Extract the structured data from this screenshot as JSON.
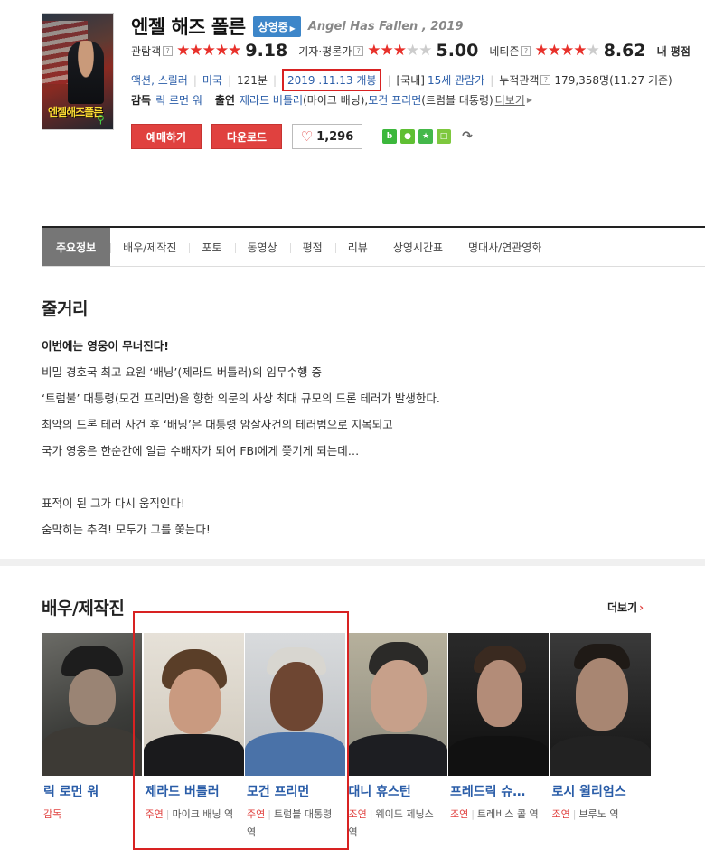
{
  "movie": {
    "poster_text": "엔젤해즈폴른",
    "title": "엔젤 해즈 폴른",
    "status": "상영중",
    "original_title": "Angel Has Fallen , 2019"
  },
  "ratings": {
    "audience": {
      "label": "관람객",
      "stars": 4.5,
      "score": "9.18"
    },
    "critics": {
      "label": "기자·평론가",
      "stars": 2.5,
      "score": "5.00"
    },
    "netizen": {
      "label": "네티즌",
      "stars": 4.5,
      "score": "8.62"
    },
    "extra": "내 평점"
  },
  "meta": {
    "genre": "액션, 스릴러",
    "country": "미국",
    "runtime": "121분",
    "release": "2019 .11.13 개봉",
    "grade_prefix": "[국내]",
    "grade": "15세 관람가",
    "audience_label": "누적관객",
    "audience_count": "179,358명",
    "audience_date": "(11.27 기준)"
  },
  "credits": {
    "director_label": "감독",
    "director": "릭 로먼 워",
    "cast_label": "출연",
    "actor1": "제라드 버틀러",
    "role1": "(마이크 배닝),",
    "actor2": "모건 프리먼",
    "role2": "(트럼블 대통령)",
    "more": "더보기"
  },
  "buttons": {
    "reserve": "예매하기",
    "download": "다운로드",
    "likes": "1,296"
  },
  "share_icons": [
    "blog-icon",
    "talk-icon",
    "star-icon",
    "square-icon",
    "share-icon"
  ],
  "tabs": [
    "주요정보",
    "배우/제작진",
    "포토",
    "동영상",
    "평점",
    "리뷰",
    "상영시간표",
    "명대사/연관영화"
  ],
  "synopsis": {
    "title": "줄거리",
    "lead": "이번에는 영웅이 무너진다!",
    "lines": [
      "비밀 경호국 최고 요원 ‘배닝’(제라드 버틀러)의 임무수행 중",
      " ‘트럼불’ 대통령(모건 프리먼)을 향한 의문의 사상 최대 규모의 드론 테러가 발생한다.",
      " 최악의 드론 테러 사건 후 ‘배닝’은 대통령 암살사건의 테러범으로 지목되고",
      " 국가 영웅은 한순간에 일급 수배자가 되어 FBI에게 쫓기게 되는데…",
      "",
      " 표적이 된 그가 다시 움직인다!",
      " 숨막히는 추격! 모두가 그를 쫓는다!"
    ]
  },
  "cast": {
    "title": "배우/제작진",
    "more": "더보기",
    "people": [
      {
        "name": "릭 로먼 워",
        "kind": "감독",
        "role": ""
      },
      {
        "name": "제라드 버틀러",
        "kind": "주연",
        "role": "마이크 배닝 역"
      },
      {
        "name": "모건 프리먼",
        "kind": "주연",
        "role": "트럼블 대통령 역"
      },
      {
        "name": "대니 휴스턴",
        "kind": "조연",
        "role": "웨이드 제닝스 역"
      },
      {
        "name": "프레드릭 슈…",
        "kind": "조연",
        "role": "트레비스 콜 역"
      },
      {
        "name": "로시 윌리엄스",
        "kind": "조연",
        "role": "브루노 역"
      }
    ]
  },
  "colors": {
    "accent_red": "#e0413f",
    "link_blue": "#2a5da8",
    "badge_blue": "#3d86c9",
    "highlight": "#d82222"
  }
}
